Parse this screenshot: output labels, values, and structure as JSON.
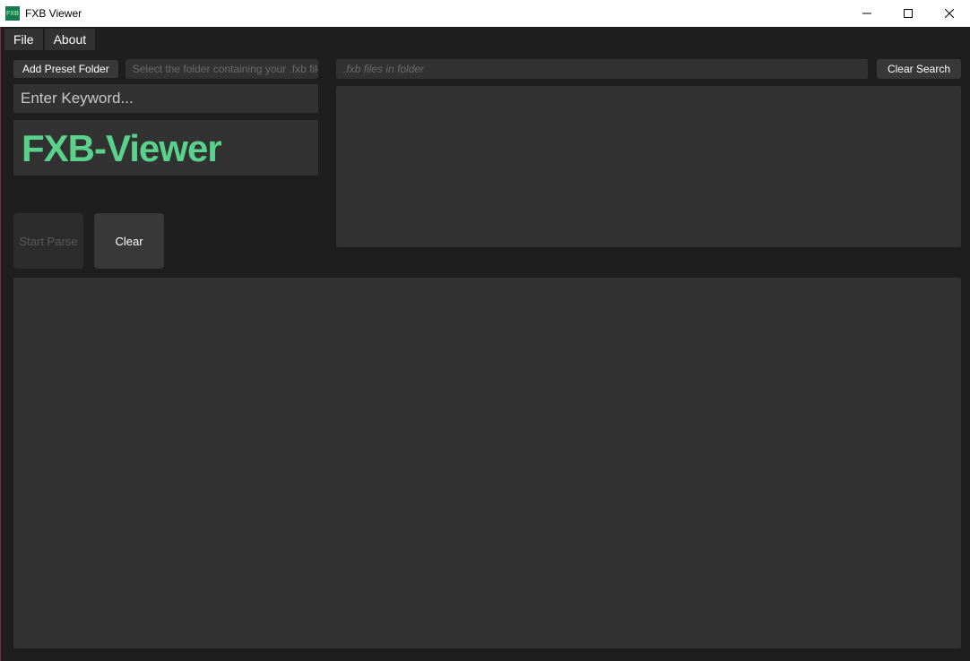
{
  "window": {
    "title": "FXB Viewer",
    "icon_text": "FXB"
  },
  "menubar": {
    "file": "File",
    "about": "About"
  },
  "left": {
    "add_preset_folder": "Add Preset Folder",
    "folder_hint": "Select the folder containing your .fxb files",
    "keyword_placeholder": "Enter Keyword...",
    "logo_text": "FXB-Viewer",
    "start_parse": "Start Parse",
    "clear": "Clear"
  },
  "right": {
    "files_placeholder": ".fxb files in folder",
    "clear_search": "Clear Search"
  },
  "colors": {
    "accent_green": "#5bd28b",
    "bg_dark": "#1e1e1e",
    "panel": "#323232",
    "border_pink": "#7a2b4a"
  }
}
